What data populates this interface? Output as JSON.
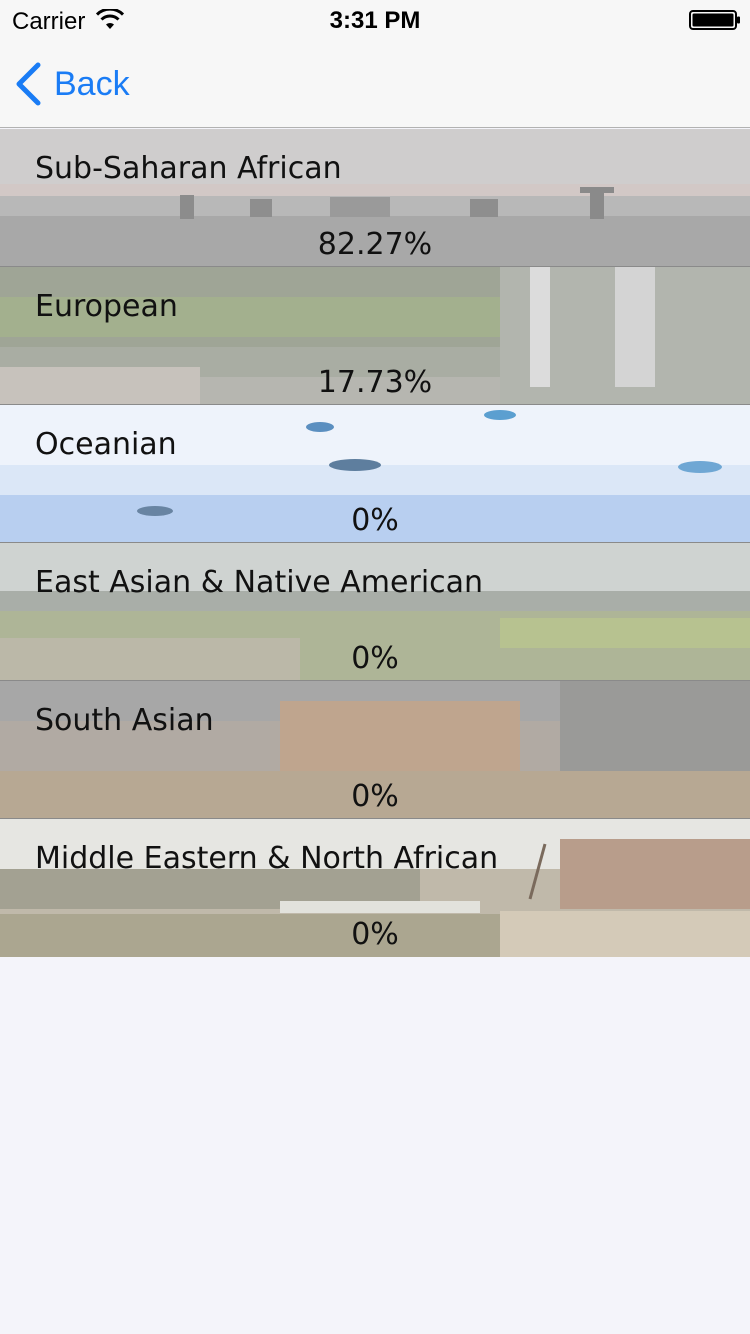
{
  "status_bar": {
    "carrier": "Carrier",
    "time": "3:31 PM"
  },
  "nav": {
    "back_label": "Back",
    "accent_color": "#1a7cf5"
  },
  "rows": [
    {
      "label": "Sub-Saharan African",
      "value": "82.27%"
    },
    {
      "label": "European",
      "value": "17.73%"
    },
    {
      "label": "Oceanian",
      "value": "0%"
    },
    {
      "label": "East Asian & Native American",
      "value": "0%"
    },
    {
      "label": "South Asian",
      "value": "0%"
    },
    {
      "label": "Middle Eastern & North African",
      "value": "0%"
    }
  ]
}
